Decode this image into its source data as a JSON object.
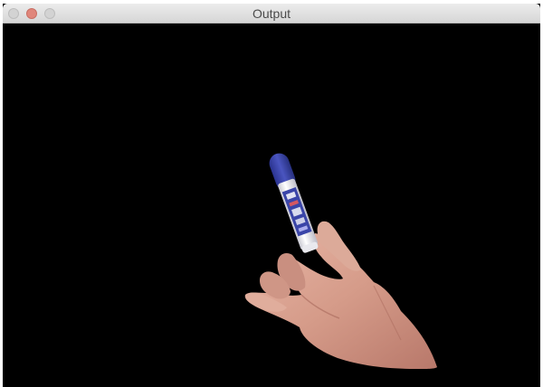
{
  "window": {
    "title": "Output"
  },
  "canvas": {
    "background": "#000000",
    "content": "hand-holding-marker"
  },
  "colors": {
    "marker_blue": "#3a45a8",
    "marker_body": "#f4f4f6",
    "skin": "#d9a08f"
  }
}
